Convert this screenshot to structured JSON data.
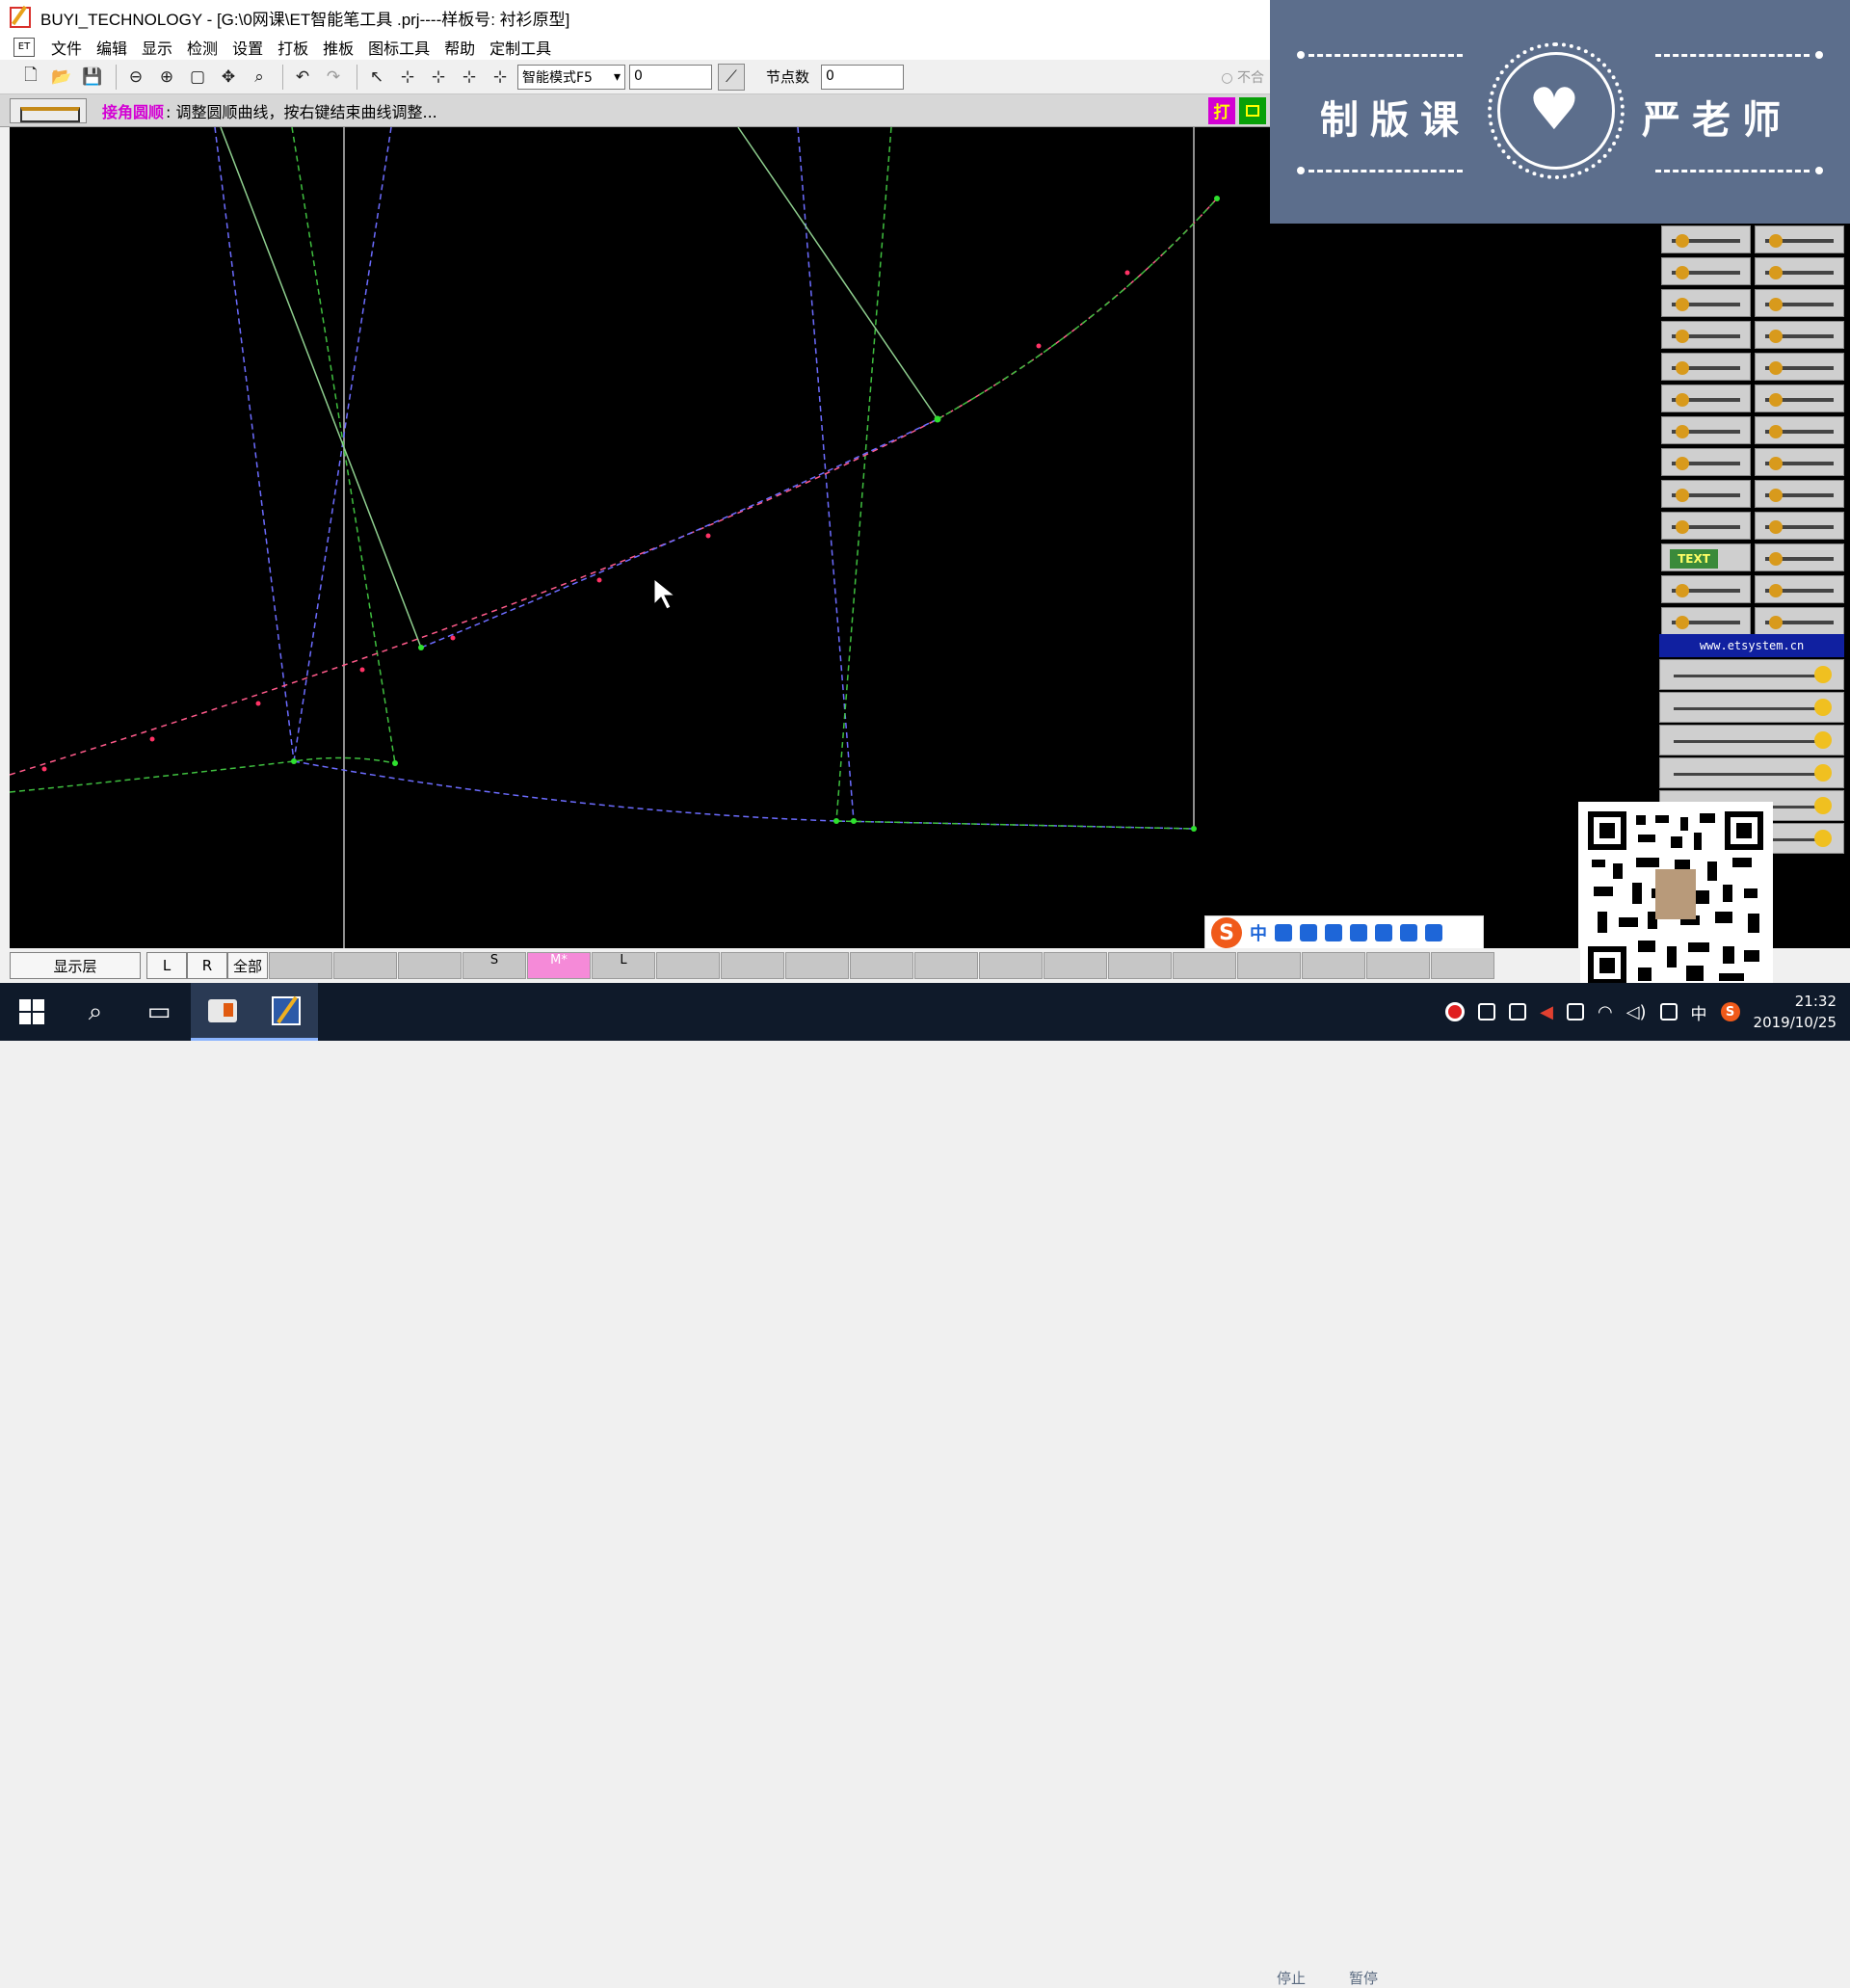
{
  "window": {
    "title": "BUYI_TECHNOLOGY - [G:\\0网课\\ET智能笔工具 .prj----样板号: 衬衫原型]"
  },
  "menu": {
    "items": [
      "文件",
      "编辑",
      "显示",
      "检测",
      "设置",
      "打板",
      "推板",
      "图标工具",
      "帮助",
      "定制工具"
    ]
  },
  "toolbar": {
    "mode_select": "智能模式F5",
    "value_input": "0",
    "node_count_label": "节点数",
    "node_count_input": "0",
    "ghost_label": "不合"
  },
  "hint": {
    "tool_name": "接角圆顺",
    "message": ": 调整圆顺曲线，按右键结束曲线调整..."
  },
  "hint_right": {
    "print_label": "打"
  },
  "watermark": {
    "left_text": "制版课",
    "right_text": "严老师"
  },
  "palette": {
    "site_label": "www.etsystem.cn",
    "text_tool_label": "TEXT"
  },
  "layerbar": {
    "display_layer": "显示层",
    "left": "L",
    "right": "R",
    "all": "全部",
    "slots": [
      "",
      "",
      "",
      "S",
      "M*",
      "L",
      "",
      "",
      "",
      "",
      "",
      "",
      "",
      "",
      "",
      "",
      "",
      "",
      ""
    ]
  },
  "ime": {
    "logo": "S",
    "lang": "中"
  },
  "taskbar": {
    "tray_lang": "中",
    "tray_s": "S",
    "time": "21:32",
    "date": "2019/10/25",
    "ghost_stop": "停止",
    "ghost_pause": "暂停"
  },
  "colors": {
    "canvas": "#000000",
    "blue_line": "#6c6cff",
    "green_line": "#3fbf3f",
    "green_solid": "#8fcf8f",
    "grey_line": "#bdbdbd",
    "accent_magenta": "#d400d4"
  }
}
